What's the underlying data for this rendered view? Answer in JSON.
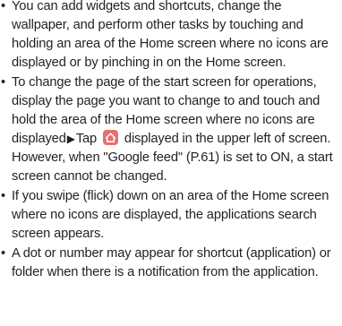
{
  "bullet_glyph": "•",
  "arrow_glyph": "▶",
  "icon": {
    "name": "home-icon",
    "color": "#e86f6f"
  },
  "items": [
    {
      "text": "You can add widgets and shortcuts, change the wallpaper, and perform other tasks by touching and holding an area of the Home screen where no icons are displayed or by pinching in on the Home screen."
    },
    {
      "text_a": "To change the page of the start screen for operations, display the page you want to change to and touch and hold the area of the Home screen where no icons are displayed",
      "text_b": "Tap",
      "text_c": "displayed in the upper left of screen. However, when \"Google feed\" (P.61) is set to ON, a start screen cannot be changed."
    },
    {
      "text": "If you swipe (flick) down on an area of the Home screen where no icons are displayed, the applications search screen appears."
    },
    {
      "text": "A dot or number may appear for shortcut (application) or folder when there is a notification from the application."
    }
  ]
}
